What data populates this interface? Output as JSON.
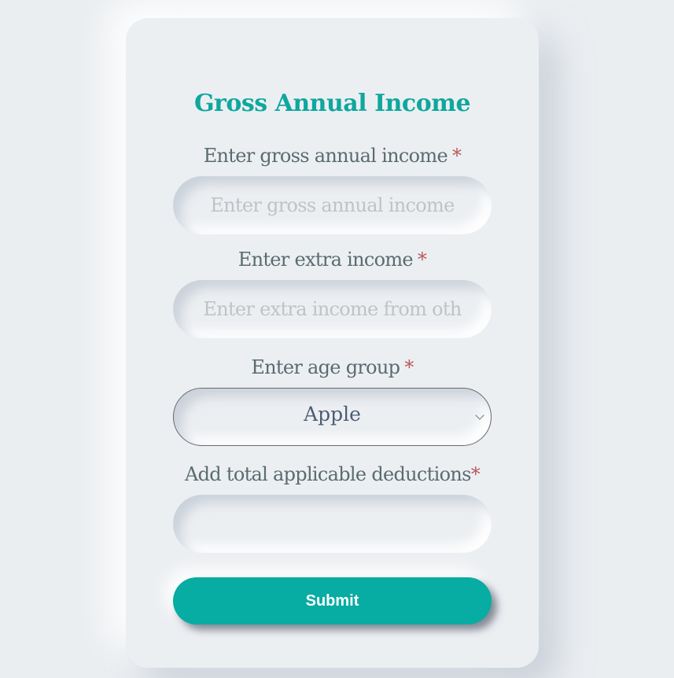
{
  "form": {
    "title": "Gross Annual Income",
    "required_marker": "*",
    "fields": [
      {
        "label": "Enter gross annual income",
        "placeholder": "Enter gross annual income",
        "value": ""
      },
      {
        "label": "Enter extra income",
        "placeholder": "Enter extra income from oth",
        "value": ""
      },
      {
        "label": "Enter age group",
        "selected": "Apple"
      },
      {
        "label": "Add total applicable deductions",
        "placeholder": "",
        "value": ""
      }
    ],
    "submit_label": "Submit"
  },
  "icons": {
    "select_arrow": "chevron-down-icon"
  },
  "colors": {
    "accent": "#07aca3",
    "title": "#0fa79e",
    "required": "#b85a5a",
    "background": "#ebeef1"
  }
}
